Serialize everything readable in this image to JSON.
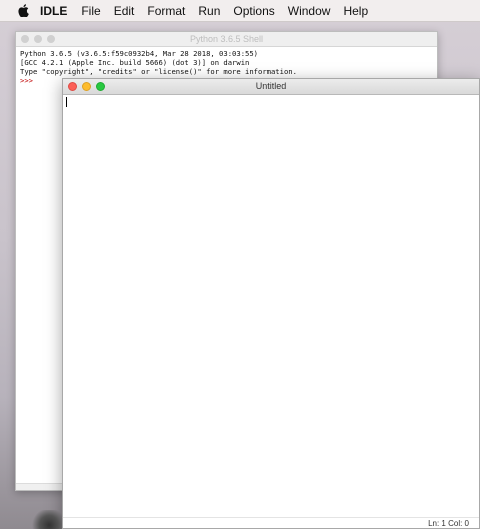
{
  "menubar": {
    "app_name": "IDLE",
    "items": [
      "File",
      "Edit",
      "Format",
      "Run",
      "Options",
      "Window",
      "Help"
    ]
  },
  "shell_window": {
    "title": "Python 3.6.5 Shell",
    "lines": [
      "Python 3.6.5 (v3.6.5:f59c0932b4, Mar 28 2018, 03:03:55)",
      "[GCC 4.2.1 (Apple Inc. build 5666) (dot 3)] on darwin",
      "Type \"copyright\", \"credits\" or \"license()\" for more information."
    ],
    "prompt": ">>>"
  },
  "editor_window": {
    "title": "Untitled",
    "status": "Ln: 1  Col: 0"
  }
}
